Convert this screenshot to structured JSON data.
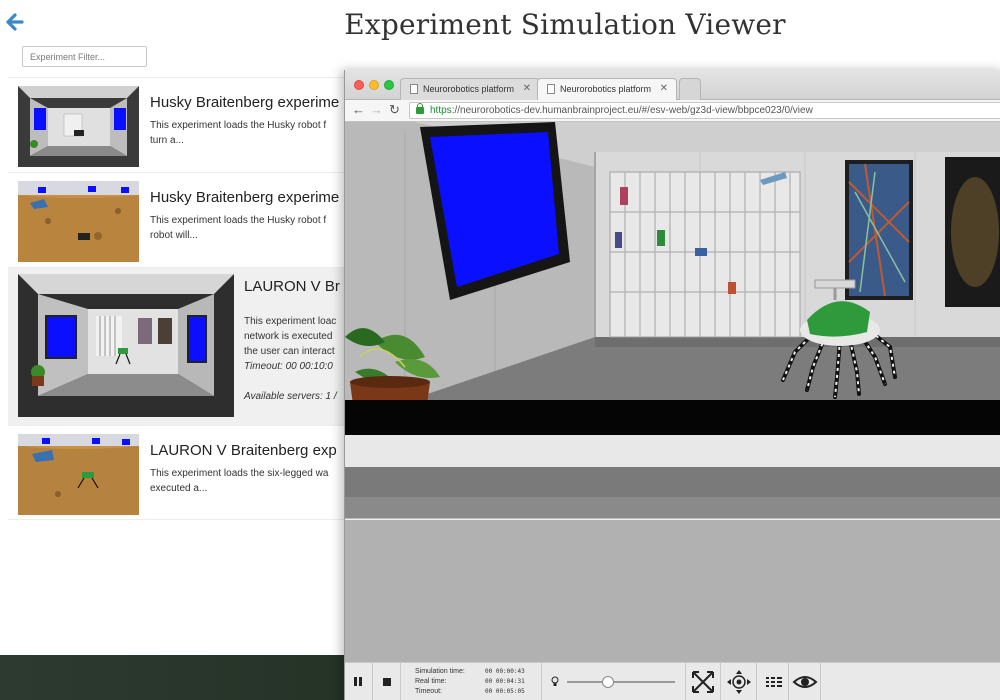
{
  "page": {
    "title": "Experiment Simulation Viewer",
    "filter_placeholder": "Experiment Filter..."
  },
  "experiments": [
    {
      "title": "Husky Braitenberg experime",
      "desc": "This experiment loads the Husky robot f\nturn a..."
    },
    {
      "title": "Husky Braitenberg experime",
      "desc": "This experiment loads the Husky robot f\nrobot will..."
    },
    {
      "title": "LAURON V Br",
      "desc": "This experiment loac\nnetwork is executed\nthe user can interact",
      "timeout": "Timeout: 00 00:10:0",
      "servers": "Available servers: 1 /"
    },
    {
      "title": "LAURON V Braitenberg exp",
      "desc": "This experiment loads the six-legged wa\nexecuted a..."
    }
  ],
  "browser": {
    "tabs": [
      {
        "label": "Neurorobotics platform",
        "active": false
      },
      {
        "label": "Neurorobotics platform",
        "active": true
      }
    ],
    "url_scheme": "https",
    "url_rest": "://neurorobotics-dev.humanbrainproject.eu/#/esv-web/gz3d-view/bbpce023/0/view"
  },
  "sim_controls": {
    "labels": {
      "sim_time": "Simulation time:",
      "real_time": "Real time:",
      "timeout": "Timeout:"
    },
    "values": {
      "sim_time": "00 00:00:43",
      "real_time": "00 00:04:31",
      "timeout": "00 00:05:05"
    },
    "light_slider_fraction": 0.38,
    "tools": [
      "pause-icon",
      "stop-icon",
      "lightbulb-icon",
      "move-arrows-icon",
      "navigation-cross-icon",
      "robot-grid-icon",
      "eye-icon"
    ]
  },
  "colors": {
    "accent": "#3b88c9",
    "screen_blue": "#0a10ff",
    "robot_green": "#2f9a3c",
    "url_green": "#1b8a2c"
  }
}
